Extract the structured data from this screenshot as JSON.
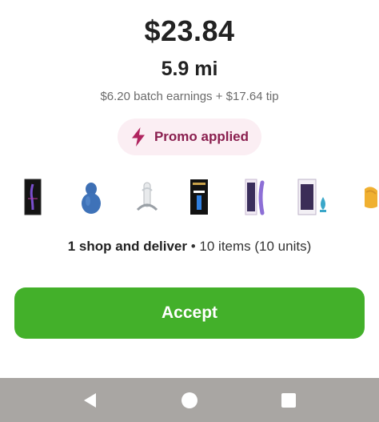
{
  "offer": {
    "amount": "$23.84",
    "distance": "5.9 mi",
    "breakdown": "$6.20 batch earnings + $17.64 tip"
  },
  "promo": {
    "label": "Promo applied",
    "icon": "lightning-bolt-icon",
    "color": "#8a1f4f",
    "background": "#fbeef3"
  },
  "products": {
    "items": [
      {
        "name": "product-1"
      },
      {
        "name": "product-2"
      },
      {
        "name": "product-3"
      },
      {
        "name": "product-4"
      },
      {
        "name": "product-5"
      },
      {
        "name": "product-6"
      },
      {
        "name": "product-7"
      }
    ]
  },
  "summary": {
    "type_label": "1 shop and deliver",
    "separator": " • ",
    "items_label": "10 items (10 units)"
  },
  "actions": {
    "accept_label": "Accept",
    "accept_color": "#43b02a"
  },
  "navbar": {
    "back_icon": "back-triangle-icon",
    "home_icon": "home-circle-icon",
    "recents_icon": "recents-square-icon",
    "background": "#a9a6a3"
  }
}
